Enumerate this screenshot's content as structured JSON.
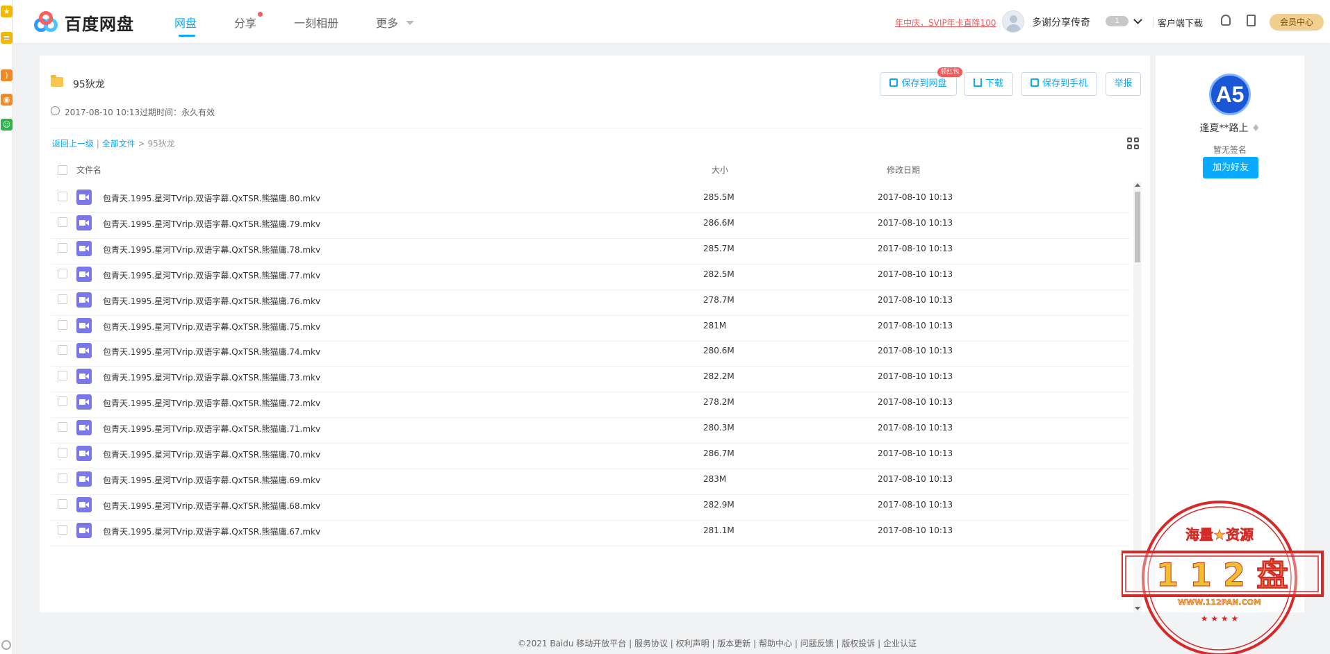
{
  "nav": {
    "logo_text": "百度网盘",
    "items": [
      "网盘",
      "分享",
      "一刻相册",
      "更多"
    ]
  },
  "header": {
    "promo": "年中庆，SVIP年卡直降100",
    "username": "多谢分享传奇",
    "vip_level": "1",
    "client_download": "客户端下载",
    "member_center": "会员中心"
  },
  "share": {
    "title": "95狄龙",
    "meta": "2017-08-10 10:13过期时间：永久有效",
    "actions": {
      "save": "保存到网盘",
      "hongbao": "领红包",
      "download": "下载",
      "save_phone": "保存到手机",
      "report": "举报"
    }
  },
  "breadcrumb": {
    "back": "返回上一级",
    "sep": "|",
    "all": "全部文件",
    "arrow": ">",
    "current": "95狄龙"
  },
  "table": {
    "headers": {
      "name": "文件名",
      "size": "大小",
      "date": "修改日期"
    },
    "rows": [
      {
        "name": "包青天.1995.星河TVrip.双语字幕.QxTSR.熊猫庸.80.mkv",
        "size": "285.5M",
        "date": "2017-08-10 10:13"
      },
      {
        "name": "包青天.1995.星河TVrip.双语字幕.QxTSR.熊猫庸.79.mkv",
        "size": "286.6M",
        "date": "2017-08-10 10:13"
      },
      {
        "name": "包青天.1995.星河TVrip.双语字幕.QxTSR.熊猫庸.78.mkv",
        "size": "285.7M",
        "date": "2017-08-10 10:13"
      },
      {
        "name": "包青天.1995.星河TVrip.双语字幕.QxTSR.熊猫庸.77.mkv",
        "size": "282.5M",
        "date": "2017-08-10 10:13"
      },
      {
        "name": "包青天.1995.星河TVrip.双语字幕.QxTSR.熊猫庸.76.mkv",
        "size": "278.7M",
        "date": "2017-08-10 10:13"
      },
      {
        "name": "包青天.1995.星河TVrip.双语字幕.QxTSR.熊猫庸.75.mkv",
        "size": "281M",
        "date": "2017-08-10 10:13"
      },
      {
        "name": "包青天.1995.星河TVrip.双语字幕.QxTSR.熊猫庸.74.mkv",
        "size": "280.6M",
        "date": "2017-08-10 10:13"
      },
      {
        "name": "包青天.1995.星河TVrip.双语字幕.QxTSR.熊猫庸.73.mkv",
        "size": "282.2M",
        "date": "2017-08-10 10:13"
      },
      {
        "name": "包青天.1995.星河TVrip.双语字幕.QxTSR.熊猫庸.72.mkv",
        "size": "278.2M",
        "date": "2017-08-10 10:13"
      },
      {
        "name": "包青天.1995.星河TVrip.双语字幕.QxTSR.熊猫庸.71.mkv",
        "size": "280.3M",
        "date": "2017-08-10 10:13"
      },
      {
        "name": "包青天.1995.星河TVrip.双语字幕.QxTSR.熊猫庸.70.mkv",
        "size": "286.7M",
        "date": "2017-08-10 10:13"
      },
      {
        "name": "包青天.1995.星河TVrip.双语字幕.QxTSR.熊猫庸.69.mkv",
        "size": "283M",
        "date": "2017-08-10 10:13"
      },
      {
        "name": "包青天.1995.星河TVrip.双语字幕.QxTSR.熊猫庸.68.mkv",
        "size": "282.9M",
        "date": "2017-08-10 10:13"
      },
      {
        "name": "包青天.1995.星河TVrip.双语字幕.QxTSR.熊猫庸.67.mkv",
        "size": "281.1M",
        "date": "2017-08-10 10:13"
      }
    ]
  },
  "sidebar": {
    "avatar_text": "A5",
    "name": "逢夏**路上",
    "signature": "暂无签名",
    "add_friend": "加为好友"
  },
  "footer": {
    "text": "©2021 Baidu  移动开放平台 | 服务协议 | 权利声明 | 版本更新 | 帮助中心 | 问题反馈 | 版权投诉 | 企业认证"
  },
  "watermark": {
    "top_text": "海量★资源",
    "main_text": "1 1 2 盘",
    "url": "WWW.112PAN.COM"
  },
  "colors": {
    "accent": "#09aaff",
    "alert": "#f25b5b",
    "video_icon": "#7a78e9",
    "stamp": "#d42a2a"
  }
}
